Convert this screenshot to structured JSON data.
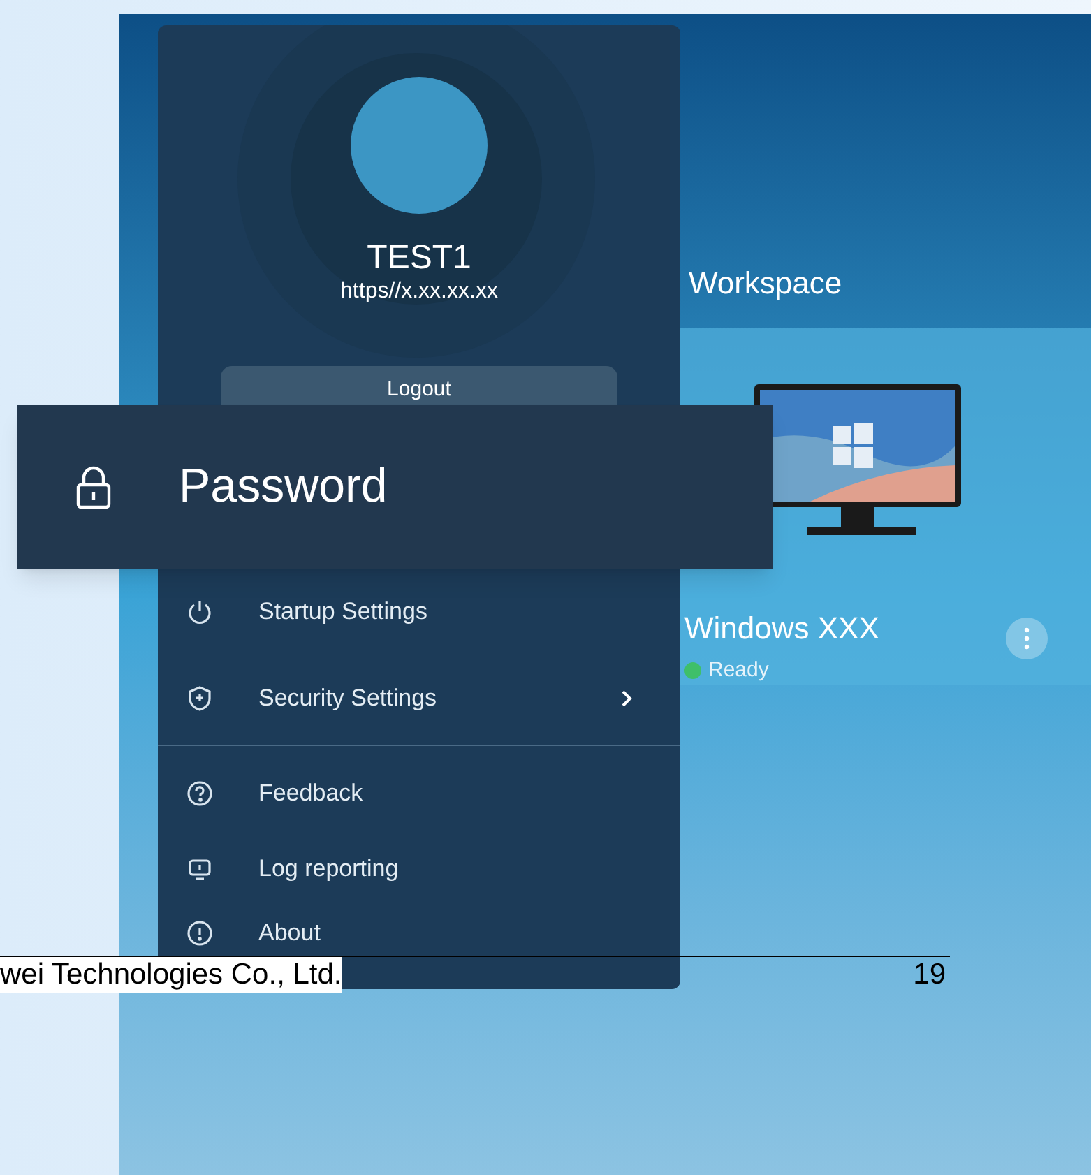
{
  "app": {
    "section_title": "Workspace",
    "desktop": {
      "name": "Windows XXX",
      "status": "Ready"
    }
  },
  "menu": {
    "user_name": "TEST1",
    "server": "https//x.xx.xx.xx",
    "logout": "Logout",
    "groups": [
      [
        {
          "label": "Startup Settings",
          "has_submenu": false
        },
        {
          "label": "Security Settings",
          "has_submenu": true
        }
      ],
      [
        {
          "label": "Feedback",
          "has_submenu": false
        },
        {
          "label": "Log reporting",
          "has_submenu": false
        },
        {
          "label": "About",
          "has_submenu": false
        }
      ]
    ]
  },
  "callout": {
    "label": "Password"
  },
  "footer": {
    "text": "wei Technologies Co., Ltd.",
    "page": "19"
  }
}
